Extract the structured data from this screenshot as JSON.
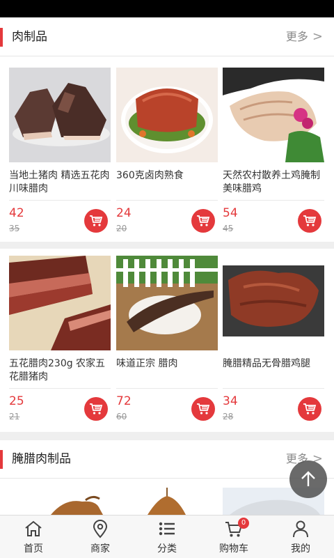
{
  "sections": [
    {
      "title": "肉制品",
      "more": "更多",
      "products": [
        {
          "name": "当地土猪肉 精选五花肉川味腊肉",
          "price": "42",
          "old_price": "35"
        },
        {
          "name": "360克卤肉熟食",
          "price": "24",
          "old_price": "20"
        },
        {
          "name": "天然农村散养土鸡腌制美味腊鸡",
          "price": "54",
          "old_price": "45"
        },
        {
          "name": "五花腊肉230g 农家五花腊猪肉",
          "price": "25",
          "old_price": "21"
        },
        {
          "name": "味道正宗 腊肉",
          "price": "72",
          "old_price": "60"
        },
        {
          "name": "腌腊精品无骨腊鸡腿",
          "price": "34",
          "old_price": "28"
        }
      ]
    },
    {
      "title": "腌腊肉制品",
      "more": "更多"
    }
  ],
  "tabbar": [
    {
      "label": "首页",
      "icon": "home-icon"
    },
    {
      "label": "商家",
      "icon": "location-pin-icon"
    },
    {
      "label": "分类",
      "icon": "list-icon"
    },
    {
      "label": "购物车",
      "icon": "cart-icon",
      "badge": "0"
    },
    {
      "label": "我的",
      "icon": "user-icon"
    }
  ],
  "colors": {
    "accent": "#e4393c",
    "background": "#efefef"
  }
}
